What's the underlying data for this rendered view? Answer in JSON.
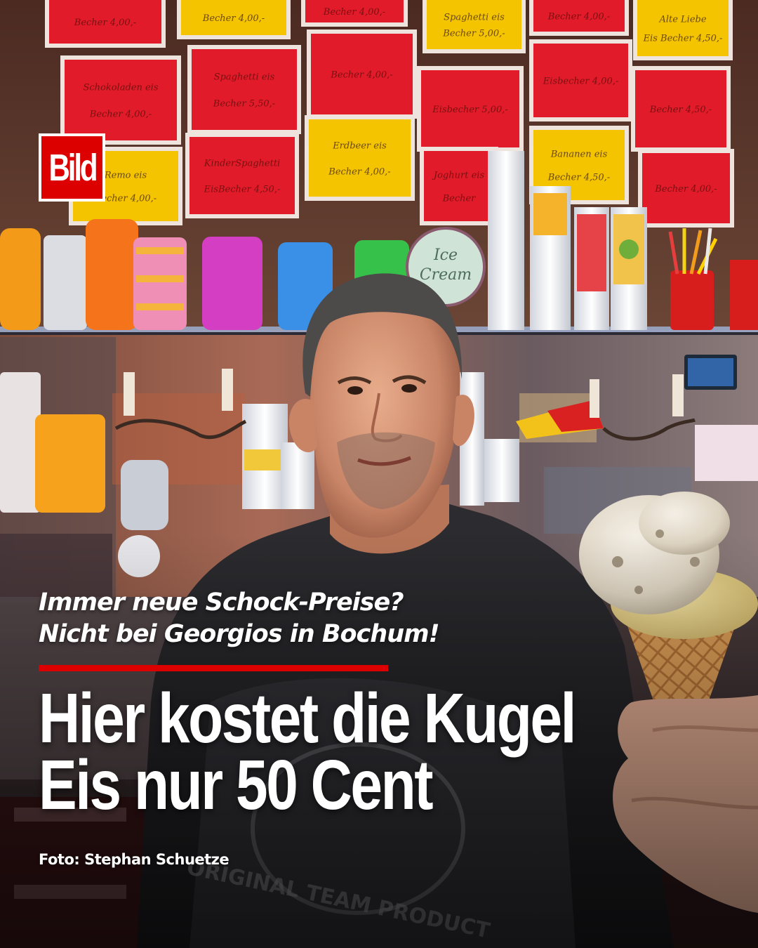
{
  "brand": {
    "logo_text": "Bild",
    "logo_color": "#dd0000"
  },
  "headline": {
    "kicker_lines": [
      "Immer neue Schock-Preise?",
      "Nicht bei Georgios in Bochum!"
    ],
    "title_lines": [
      "Hier kostet die Kugel",
      "Eis nur 50 Cent"
    ],
    "accent_color": "#dd0000"
  },
  "photo": {
    "credit": "Foto: Stephan Schuetze",
    "price_signs": [
      {
        "text": [
          "Becher 4,00,-"
        ],
        "color": "#e21b2b"
      },
      {
        "text": [
          "Becher 4,00,-"
        ],
        "color": "#f5c400"
      },
      {
        "text": [
          "Becher 4,00,-"
        ],
        "color": "#e21b2b"
      },
      {
        "text": [
          "Spaghetti eis",
          "Becher 5,00,-"
        ],
        "color": "#f5c400"
      },
      {
        "text": [
          "Becher 4,00,-"
        ],
        "color": "#e21b2b"
      },
      {
        "text": [
          "Alte Liebe",
          "Eis Becher 4,50,-"
        ],
        "color": "#f5c400"
      },
      {
        "text": [
          "Schokoladen eis",
          "Becher 4,00,-"
        ],
        "color": "#e21b2b"
      },
      {
        "text": [
          "Spaghetti eis",
          "Becher 5,50,-"
        ],
        "color": "#e21b2b"
      },
      {
        "text": [
          "Becher 4,00,-"
        ],
        "color": "#e21b2b"
      },
      {
        "text": [
          "Eisbecher 5,00,-"
        ],
        "color": "#e21b2b"
      },
      {
        "text": [
          "Eisbecher 4,00,-"
        ],
        "color": "#e21b2b"
      },
      {
        "text": [
          "Becher 4,50,-"
        ],
        "color": "#e21b2b"
      },
      {
        "text": [
          "Remo eis",
          "Becher 4,00,-"
        ],
        "color": "#f5c400"
      },
      {
        "text": [
          "KinderSpaghetti",
          "EisBecher 4,50,-"
        ],
        "color": "#e21b2b"
      },
      {
        "text": [
          "Erdbeer eis",
          "Becher 4,00,-"
        ],
        "color": "#f5c400"
      },
      {
        "text": [
          "Joghurt eis",
          "Becher"
        ],
        "color": "#e21b2b"
      },
      {
        "text": [
          "Bananen eis",
          "Becher 4,50,-"
        ],
        "color": "#f5c400"
      },
      {
        "text": [
          "Becher 4,00,-"
        ],
        "color": "#e21b2b"
      }
    ],
    "shelf_signs": {
      "ice_cream_sign": [
        "Ice",
        "Cream"
      ],
      "tshirt_text": [
        "ORIGINAL TEAM PRODUCT"
      ]
    }
  }
}
